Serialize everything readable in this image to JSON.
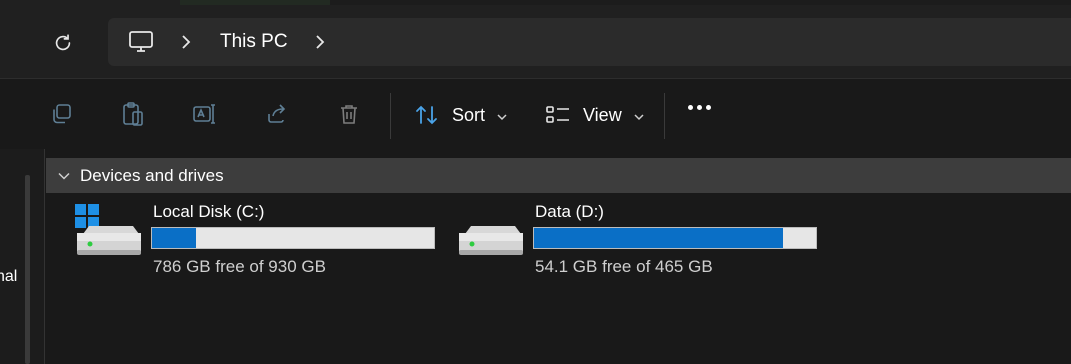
{
  "address_bar": {
    "crumbs": [
      "This PC"
    ]
  },
  "toolbar": {
    "sort_label": "Sort",
    "view_label": "View"
  },
  "nav": {
    "partial_text": "nal"
  },
  "group": {
    "title": "Devices and drives"
  },
  "drives": [
    {
      "name": "Local Disk (C:)",
      "free_text": "786 GB free of 930 GB",
      "used_fraction": 0.155
    },
    {
      "name": "Data (D:)",
      "free_text": "54.1 GB free of 465 GB",
      "used_fraction": 0.884
    }
  ],
  "colors": {
    "accent": "#0a6fc6",
    "windows_logo": "#1e90e6"
  }
}
